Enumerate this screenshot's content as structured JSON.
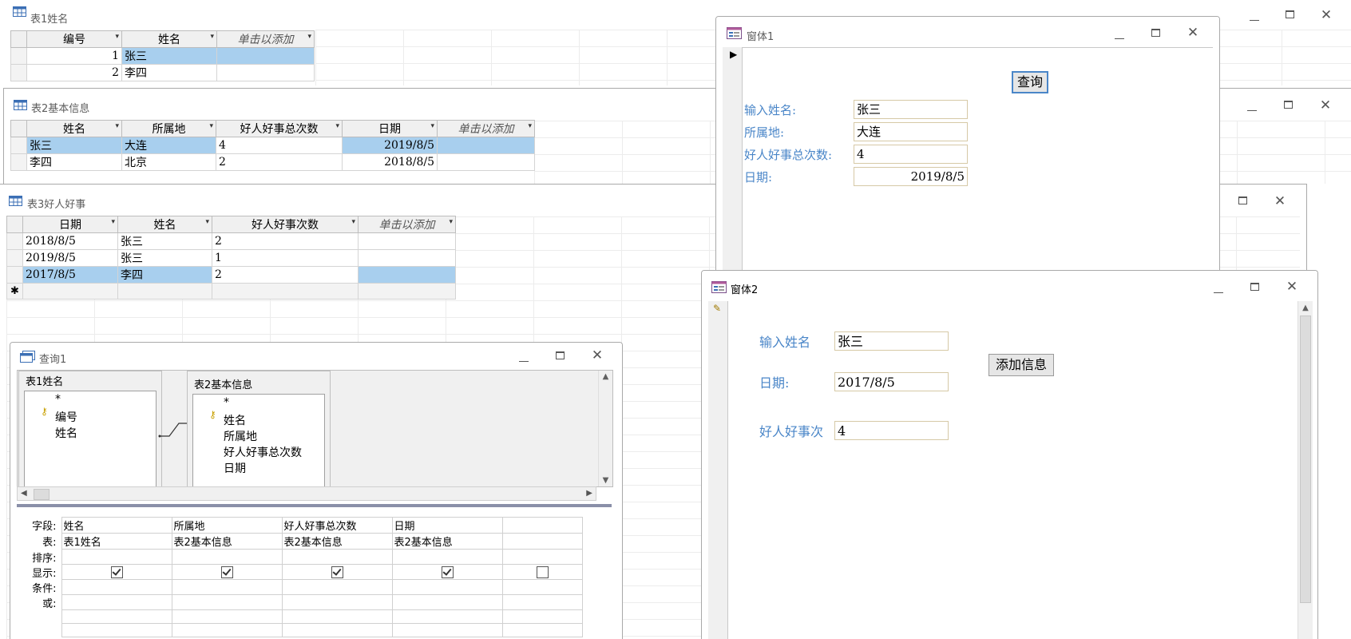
{
  "table1": {
    "title": "表1姓名",
    "columns": [
      "编号",
      "姓名",
      "单击以添加"
    ],
    "rows": [
      {
        "id": "1",
        "name": "张三"
      },
      {
        "id": "2",
        "name": "李四"
      }
    ]
  },
  "table2": {
    "title": "表2基本信息",
    "columns": [
      "姓名",
      "所属地",
      "好人好事总次数",
      "日期",
      "单击以添加"
    ],
    "rows": [
      {
        "name": "张三",
        "place": "大连",
        "count": "4",
        "date": "2019/8/5"
      },
      {
        "name": "李四",
        "place": "北京",
        "count": "2",
        "date": "2018/8/5"
      }
    ]
  },
  "table3": {
    "title": "表3好人好事",
    "columns": [
      "日期",
      "姓名",
      "好人好事次数",
      "单击以添加"
    ],
    "rows": [
      {
        "date": "2018/8/5",
        "name": "张三",
        "count": "2"
      },
      {
        "date": "2019/8/5",
        "name": "张三",
        "count": "1"
      },
      {
        "date": "2017/8/5",
        "name": "李四",
        "count": "2"
      }
    ],
    "new_row_marker": "✱"
  },
  "form1": {
    "title": "窗体1",
    "query_button": "查询",
    "labels": {
      "name": "输入姓名:",
      "place": "所属地:",
      "count": "好人好事总次数:",
      "date": "日期:"
    },
    "values": {
      "name": "张三",
      "place": "大连",
      "count": "4",
      "date": "2019/8/5"
    }
  },
  "form2": {
    "title": "窗体2",
    "labels": {
      "name": "输入姓名",
      "date": "日期:",
      "count": "好人好事次"
    },
    "values": {
      "name": "张三",
      "date": "2017/8/5",
      "count": "4"
    },
    "add_button": "添加信息"
  },
  "query1": {
    "title": "查询1",
    "list1": {
      "title": "表1姓名",
      "fields": [
        "*",
        "编号",
        "姓名"
      ]
    },
    "list2": {
      "title": "表2基本信息",
      "fields": [
        "*",
        "姓名",
        "所属地",
        "好人好事总次数",
        "日期"
      ]
    },
    "row_labels": {
      "field": "字段:",
      "table": "表:",
      "sort": "排序:",
      "show": "显示:",
      "criteria": "条件:",
      "or": "或:"
    },
    "columns": [
      {
        "field": "姓名",
        "table": "表1姓名",
        "show": true
      },
      {
        "field": "所属地",
        "table": "表2基本信息",
        "show": true
      },
      {
        "field": "好人好事总次数",
        "table": "表2基本信息",
        "show": true
      },
      {
        "field": "日期",
        "table": "表2基本信息",
        "show": true
      },
      {
        "field": "",
        "table": "",
        "show": false
      }
    ]
  },
  "colors": {
    "selection": "#a8cfee",
    "label_blue": "#4a86c8",
    "field_border": "#d6c9a6"
  },
  "icons": [
    "table-icon",
    "form-icon",
    "query-icon",
    "key-icon",
    "record-selector-arrow-icon",
    "pencil-icon",
    "minimize-icon",
    "restore-icon",
    "close-icon"
  ]
}
